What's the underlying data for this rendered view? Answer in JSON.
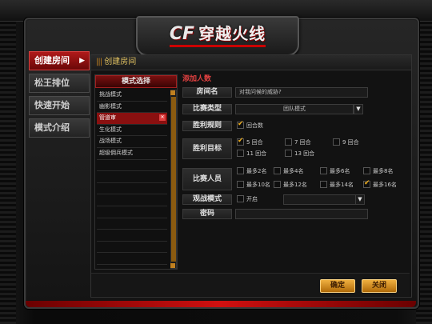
{
  "logo": {
    "cf": "CF",
    "cn": "穿越火线"
  },
  "sidebar": {
    "items": [
      {
        "label": "创建房间",
        "active": true
      },
      {
        "label": "松王排位"
      },
      {
        "label": "快速开始"
      },
      {
        "label": "模式介绍"
      }
    ]
  },
  "panel": {
    "title": "创建房间"
  },
  "mode_select": {
    "title": "模式选择",
    "items": [
      "挑战模式",
      "幽影模式",
      "管道审",
      "生化模式",
      "战场模式",
      "超级佣兵模式"
    ],
    "selected_index": 2
  },
  "settings": {
    "section_title": "添加人数",
    "room_name": {
      "label": "房间名",
      "value": "对我问候的威胁?"
    },
    "match_type": {
      "label": "比赛类型",
      "value": "团队模式"
    },
    "win_rule": {
      "label": "胜利规则",
      "option": "回合数",
      "checked": true
    },
    "win_target": {
      "label": "胜利目标",
      "options": [
        {
          "text": "5 回合",
          "checked": true
        },
        {
          "text": "7 回合"
        },
        {
          "text": "9 回合"
        },
        {
          "text": "11 回合"
        },
        {
          "text": "13 回合"
        }
      ]
    },
    "players": {
      "label": "比赛人员",
      "options": [
        {
          "text": "最多2名"
        },
        {
          "text": "最多4名"
        },
        {
          "text": "最多6名"
        },
        {
          "text": "最多8名"
        },
        {
          "text": "最多10名"
        },
        {
          "text": "最多12名"
        },
        {
          "text": "最多14名"
        },
        {
          "text": "最多16名",
          "checked": true
        }
      ]
    },
    "watch_mode": {
      "label": "观战模式",
      "option": "开启"
    },
    "password": {
      "label": "密码"
    }
  },
  "buttons": {
    "ok": "确定",
    "close": "关闭"
  }
}
